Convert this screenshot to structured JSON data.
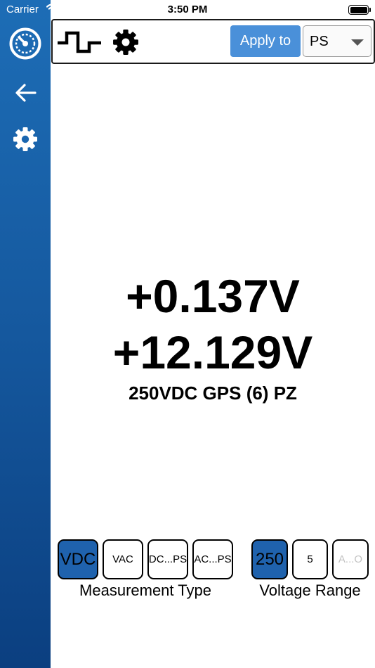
{
  "status_bar": {
    "carrier": "Carrier",
    "time": "3:50 PM"
  },
  "sidebar": {
    "items": [
      {
        "icon": "gauge-logo-icon"
      },
      {
        "icon": "back-arrow-icon"
      },
      {
        "icon": "gear-icon"
      }
    ],
    "colors": {
      "top": "#1d6db6",
      "bottom": "#0b3f80"
    }
  },
  "toolbar": {
    "mode_icon": "pulse-wave-icon",
    "settings_icon": "gear-icon",
    "apply_label": "Apply to",
    "select": {
      "value": "PS"
    }
  },
  "readings": {
    "primary": "+0.137V",
    "secondary": "+12.129V",
    "description": "250VDC GPS (6) PZ"
  },
  "measurement_type": {
    "label": "Measurement Type",
    "options": [
      {
        "label": "VDC",
        "selected": true
      },
      {
        "label": "VAC",
        "selected": false
      },
      {
        "label": "DC...PS",
        "selected": false
      },
      {
        "label": "AC...PS",
        "selected": false
      }
    ]
  },
  "voltage_range": {
    "label": "Voltage Range",
    "options": [
      {
        "label": "250",
        "selected": true
      },
      {
        "label": "5",
        "selected": false
      },
      {
        "label": "A...O",
        "selected": false,
        "disabled": true
      }
    ]
  },
  "colors": {
    "accent": "#4a90d9",
    "selected": "#1f62ad"
  }
}
